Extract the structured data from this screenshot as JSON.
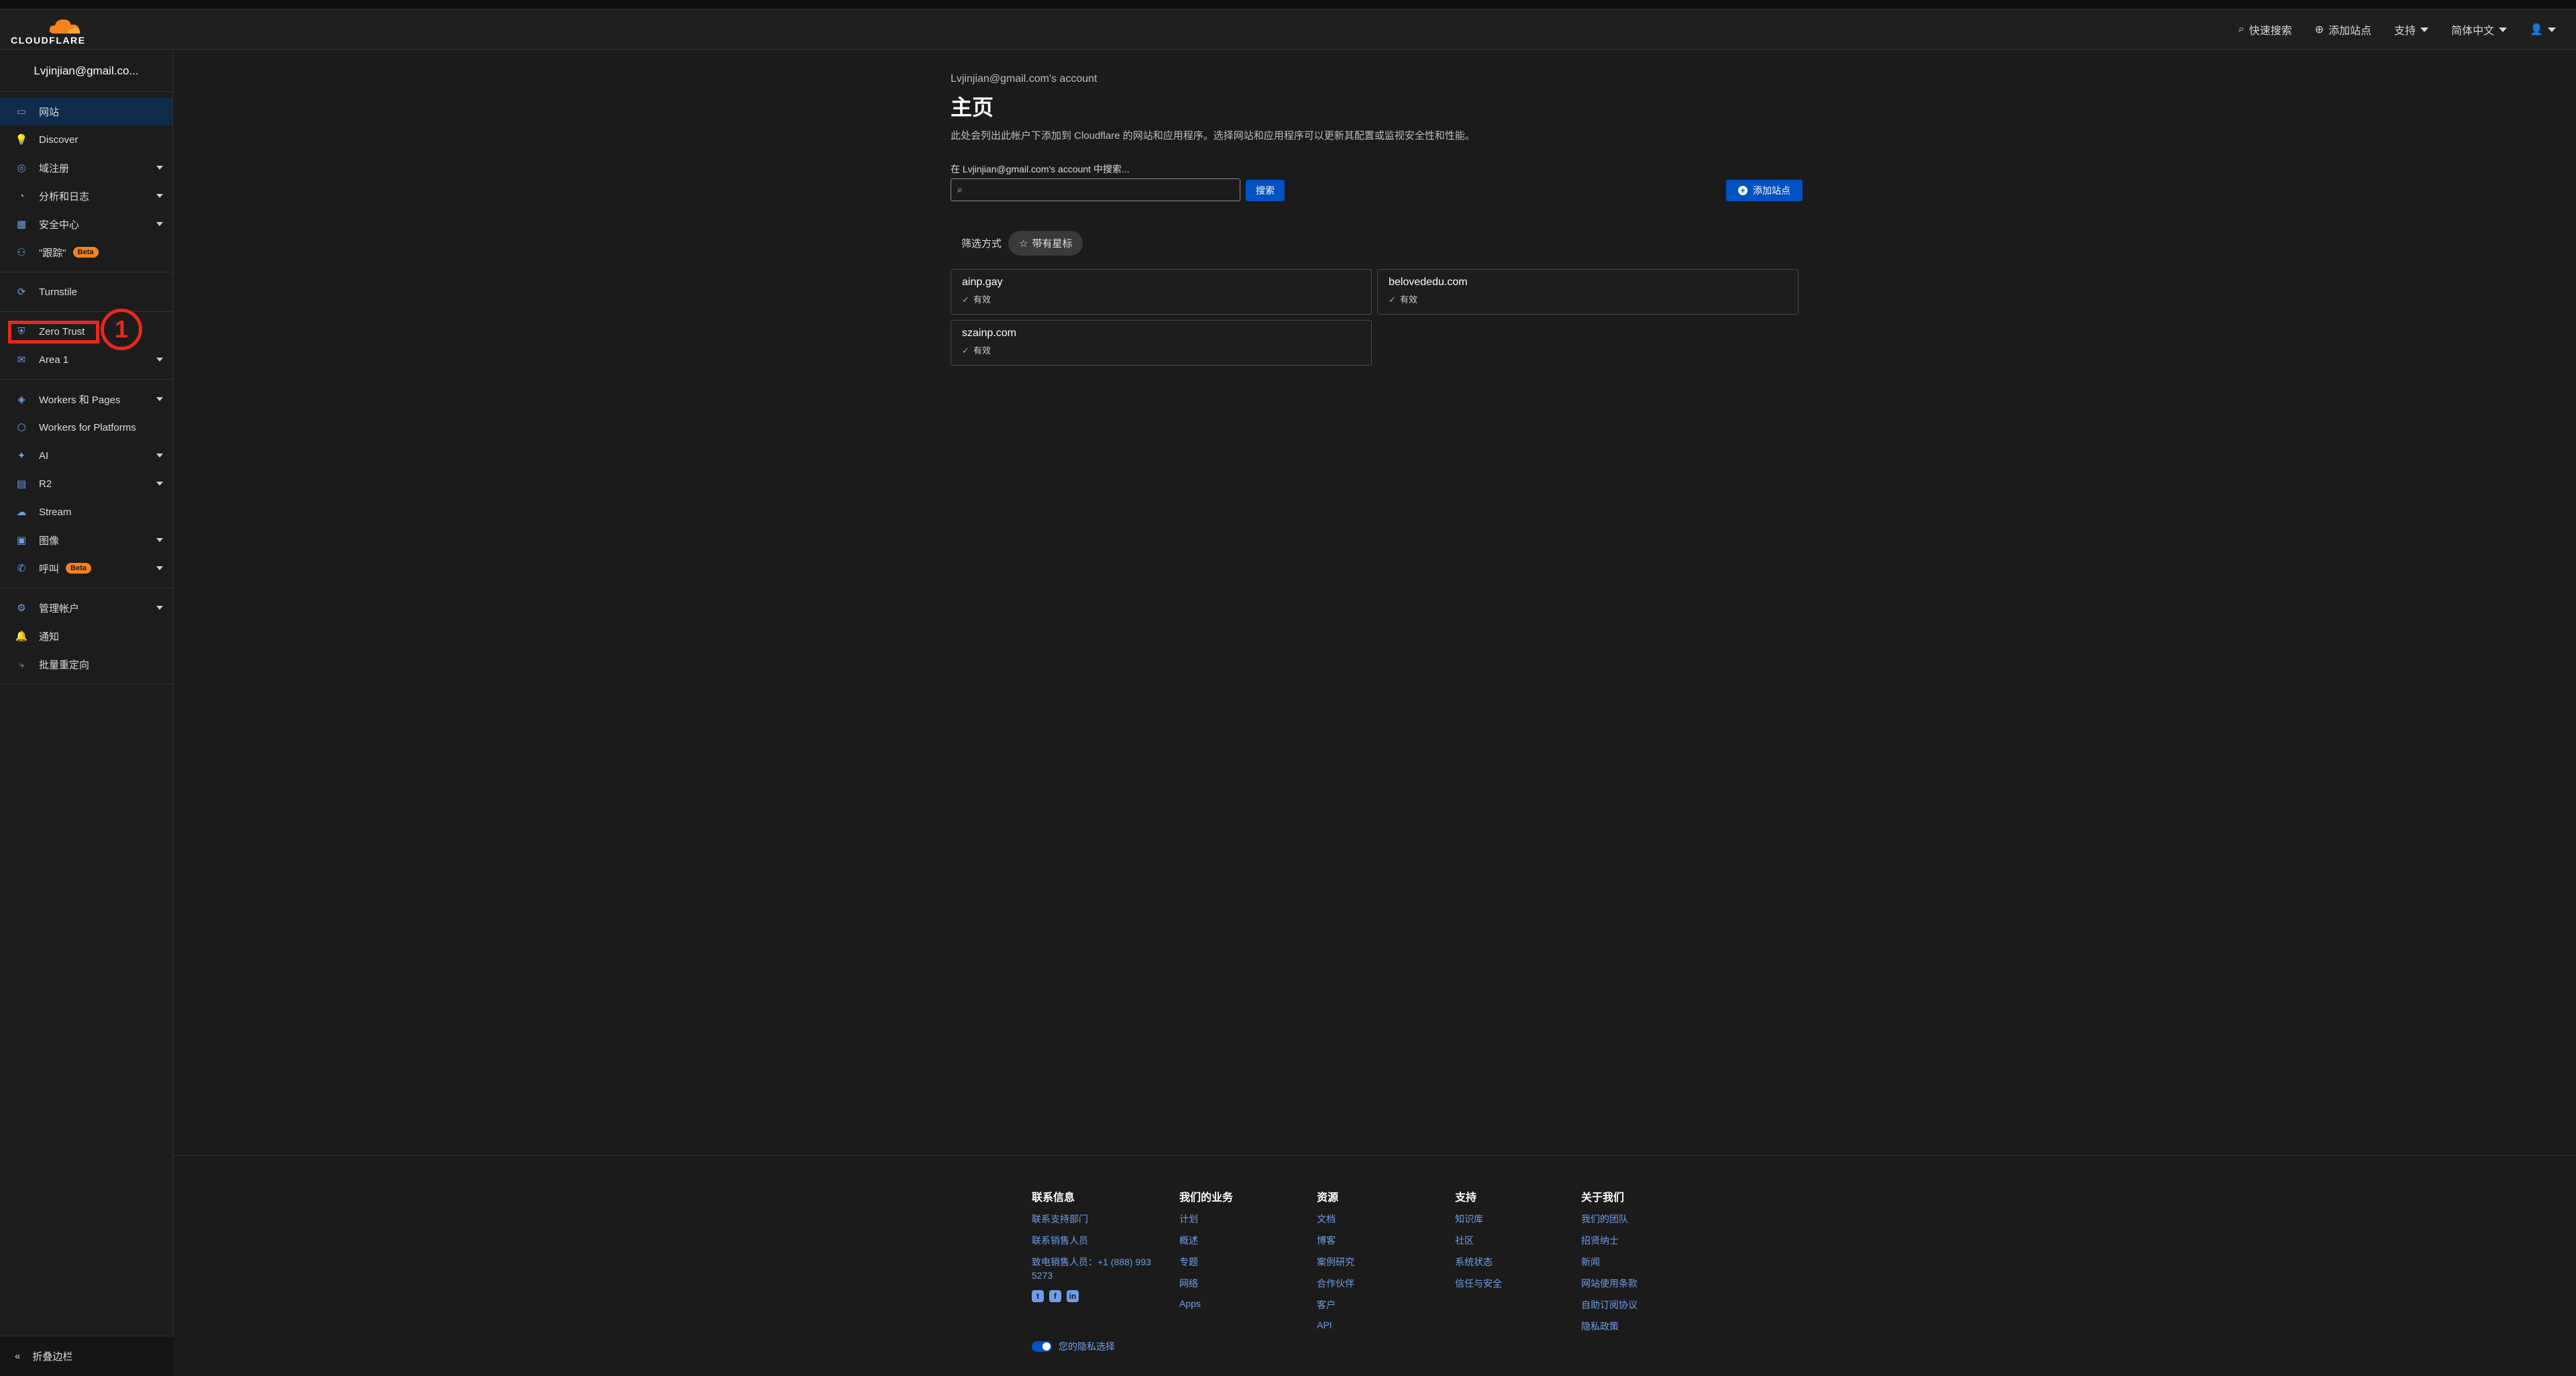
{
  "header": {
    "logo_text": "CLOUDFLARE",
    "quick_search": "快速搜索",
    "add_site": "添加站点",
    "support": "支持",
    "language": "简体中文"
  },
  "sidebar": {
    "account": "Lvjinjian@gmail.co...",
    "groups": [
      [
        {
          "label": "网站",
          "icon": "browser-icon",
          "active": true
        },
        {
          "label": "Discover",
          "icon": "lightbulb-icon"
        },
        {
          "label": "域注册",
          "icon": "globe-icon",
          "dropdown": true
        },
        {
          "label": "分析和日志",
          "icon": "chart-clock-icon",
          "dropdown": true
        },
        {
          "label": "安全中心",
          "icon": "grid-icon",
          "dropdown": true
        },
        {
          "label": "\"跟踪\"",
          "icon": "people-icon",
          "badge": "Beta"
        }
      ],
      [
        {
          "label": "Turnstile",
          "icon": "turnstile-icon"
        }
      ],
      [
        {
          "label": "Zero Trust",
          "icon": "shield-icon"
        },
        {
          "label": "Area 1",
          "icon": "mail-icon",
          "dropdown": true
        }
      ],
      [
        {
          "label": "Workers 和 Pages",
          "icon": "workers-icon",
          "dropdown": true
        },
        {
          "label": "Workers for Platforms",
          "icon": "cube-icon"
        },
        {
          "label": "AI",
          "icon": "ai-icon",
          "dropdown": true
        },
        {
          "label": "R2",
          "icon": "database-icon",
          "dropdown": true
        },
        {
          "label": "Stream",
          "icon": "cloud-icon"
        },
        {
          "label": "图像",
          "icon": "image-icon",
          "dropdown": true
        },
        {
          "label": "呼叫",
          "icon": "phone-icon",
          "badge": "Beta",
          "dropdown": true
        }
      ],
      [
        {
          "label": "管理帐户",
          "icon": "gear-icon",
          "dropdown": true
        },
        {
          "label": "通知",
          "icon": "bell-icon"
        },
        {
          "label": "批量重定向",
          "icon": "redirect-icon"
        }
      ]
    ],
    "collapse": "折叠边栏",
    "annotation_number": "1"
  },
  "main": {
    "account_sub": "Lvjinjian@gmail.com's account",
    "title": "主页",
    "description": "此处会列出此帐户下添加到 Cloudflare 的网站和应用程序。选择网站和应用程序可以更新其配置或监视安全性和性能。",
    "search_label": "在 Lvjinjian@gmail.com's account 中搜索...",
    "search_button": "搜索",
    "add_button": "添加站点",
    "filter_label": "筛选方式",
    "filter_chip": "带有星标",
    "sites": [
      {
        "domain": "ainp.gay",
        "status": "有效"
      },
      {
        "domain": "belovededu.com",
        "status": "有效"
      },
      {
        "domain": "szainp.com",
        "status": "有效"
      }
    ]
  },
  "footer": {
    "columns": [
      {
        "title": "联系信息",
        "links": [
          "联系支持部门",
          "联系销售人员",
          "致电销售人员：+1 (888) 993 5273"
        ]
      },
      {
        "title": "我们的业务",
        "links": [
          "计划",
          "概述",
          "专题",
          "网络",
          "Apps"
        ]
      },
      {
        "title": "资源",
        "links": [
          "文档",
          "博客",
          "案例研究",
          "合作伙伴",
          "客户",
          "API"
        ]
      },
      {
        "title": "支持",
        "links": [
          "知识库",
          "社区",
          "系统状态",
          "信任与安全"
        ]
      },
      {
        "title": "关于我们",
        "links": [
          "我们的团队",
          "招贤纳士",
          "新闻",
          "网站使用条款",
          "自助订阅协议",
          "隐私政策"
        ]
      }
    ],
    "privacy": "您的隐私选择"
  }
}
